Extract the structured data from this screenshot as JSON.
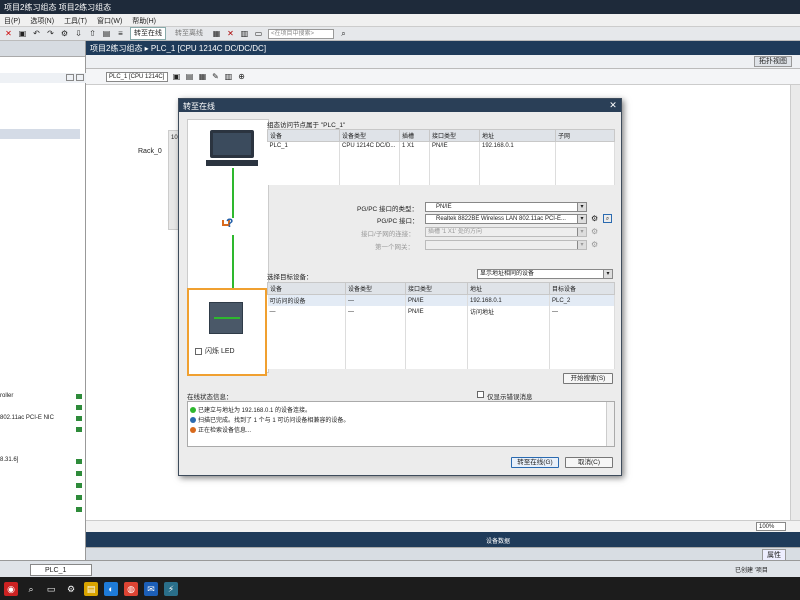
{
  "window": {
    "title": "项目2练习组态 项目2练习组态"
  },
  "menu": [
    "目(P)",
    "选项(N)",
    "工具(T)",
    "窗口(W)",
    "帮助(H)"
  ],
  "toolbar": {
    "go_online": "转至在线",
    "go_offline": "转至离线",
    "search_placeholder": "<在项目中搜索>"
  },
  "editor": {
    "breadcrumb": "项目2练习组态 ▸ PLC_1 [CPU 1214C DC/DC/DC]",
    "topology_view": "拓扑视图",
    "device_select": "PLC_1 [CPU 1214C]",
    "rack_label": "Rack_0",
    "rack_slot": "10",
    "zoom": "100%",
    "device_data_label": "设备数据",
    "properties": "属性"
  },
  "left_panel": {
    "items": [
      "roller",
      "802.11ac PCI-E NIC",
      "8.31.6]"
    ]
  },
  "portal": {
    "tab_plc": "PLC_1",
    "status": "已创建 '项目"
  },
  "dialog": {
    "title": "转至在线",
    "configured_title": "组态访问节点属于 \"PLC_1\"",
    "configured_headers": [
      "设备",
      "设备类型",
      "插槽",
      "接口类型",
      "地址",
      "子网"
    ],
    "configured_rows": [
      [
        "PLC_1",
        "CPU 1214C DC/D...",
        "1 X1",
        "PN/IE",
        "192.168.0.1",
        ""
      ]
    ],
    "pgpc_type_label": "PG/PC 接口的类型：",
    "pgpc_type_value": "PN/IE",
    "pgpc_iface_label": "PG/PC 接口：",
    "pgpc_iface_value": "Realtek 8822BE Wireless LAN 802.11ac PCI-E...",
    "subnet_conn_label": "接口/子网的连接：",
    "subnet_conn_value": "插槽 '1 X1' 处的方向",
    "gateway_label": "第一个网关：",
    "gateway_value": "",
    "led_label": "闪烁 LED",
    "target_label": "选择目标设备：",
    "target_filter": "显示地址相同的设备",
    "target_headers": [
      "设备",
      "设备类型",
      "接口类型",
      "地址",
      "目标设备"
    ],
    "target_rows": [
      [
        "可访问的设备",
        "—",
        "PN/IE",
        "192.168.0.1",
        "PLC_2"
      ],
      [
        "—",
        "—",
        "PN/IE",
        "访问地址",
        "—"
      ]
    ],
    "start_search": "开始搜索(S)",
    "status_label": "在线状态信息：",
    "errors_only": "仅显示错误消息",
    "messages": [
      "已建立与地址为 192.168.0.1 的设备连接。",
      "扫描已完成。找到了 1 个与 1 可访问设备相兼容的设备。",
      "正在检索设备信息..."
    ],
    "go_online_btn": "转至在线(G)",
    "cancel_btn": "取消(C)"
  },
  "colors": {
    "accent": "#2a3f57",
    "link_green": "#2eb82e",
    "highlight_orange": "#f0a030"
  }
}
